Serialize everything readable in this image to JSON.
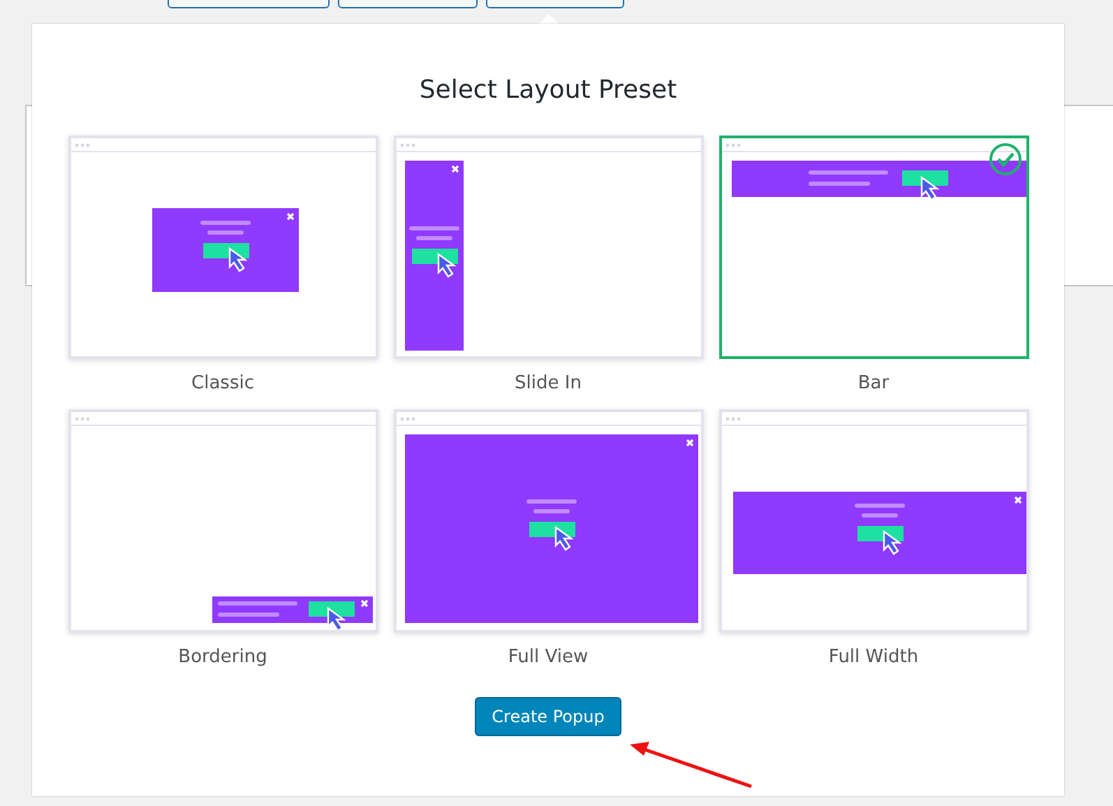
{
  "dialog": {
    "title": "Select Layout Preset",
    "presets": [
      {
        "kind": "classic",
        "label": "Classic",
        "selected": false
      },
      {
        "kind": "slide-in",
        "label": "Slide In",
        "selected": false
      },
      {
        "kind": "bar",
        "label": "Bar",
        "selected": true
      },
      {
        "kind": "bordering",
        "label": "Bordering",
        "selected": false
      },
      {
        "kind": "full-view",
        "label": "Full View",
        "selected": false
      },
      {
        "kind": "full-width",
        "label": "Full Width",
        "selected": false
      }
    ],
    "button": "Create Popup"
  }
}
